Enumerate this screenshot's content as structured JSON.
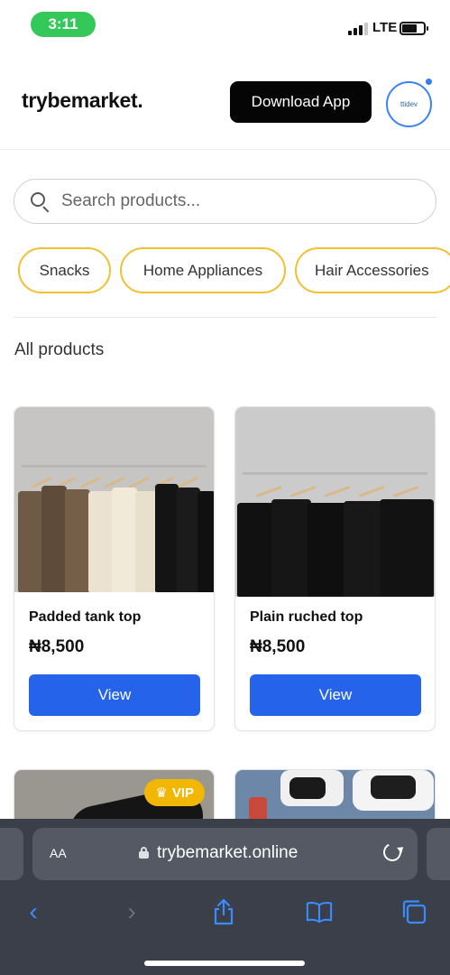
{
  "status_bar": {
    "time": "3:11",
    "network": "LTE"
  },
  "header": {
    "logo_text": "trybemarket.",
    "download_label": "Download App",
    "avatar_text": "ttidev"
  },
  "search": {
    "placeholder": "Search products..."
  },
  "categories": [
    "Snacks",
    "Home Appliances",
    "Hair Accessories"
  ],
  "section_title": "All products",
  "products": [
    {
      "name": "Padded tank top",
      "price": "₦8,500",
      "view_label": "View"
    },
    {
      "name": "Plain ruched top",
      "price": "₦8,500",
      "view_label": "View"
    }
  ],
  "badges": {
    "vip_label": "VIP"
  },
  "browser": {
    "aa_label": "AA",
    "url": "trybemarket.online"
  },
  "colors": {
    "primary_blue": "#2563eb",
    "chip_border": "#f0c030",
    "vip_yellow": "#f2b705",
    "status_green": "#34c759"
  }
}
